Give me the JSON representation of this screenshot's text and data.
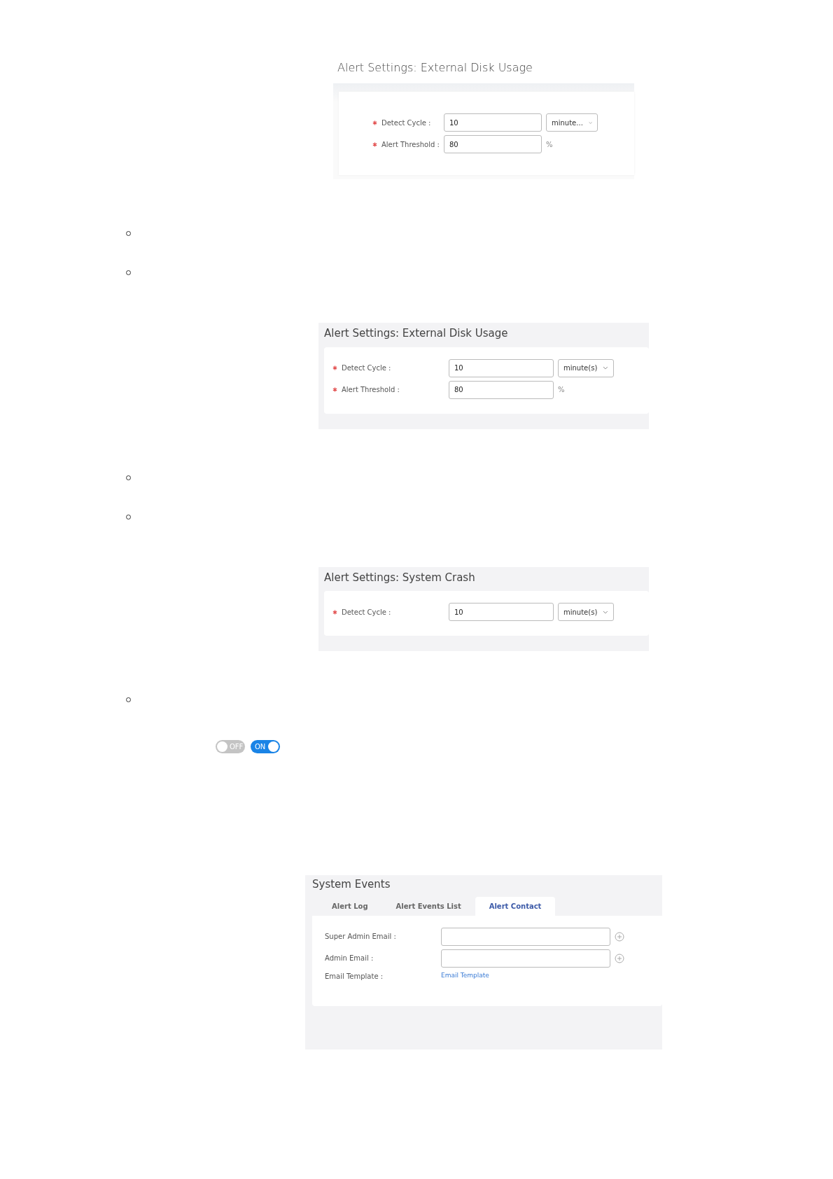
{
  "blocks": [
    {
      "kind": "framed",
      "title": "Alert Settings: External Disk Usage",
      "fields": [
        {
          "kind": "select",
          "required": true,
          "label": "Detect Cycle :",
          "value": "10",
          "option": "minute..."
        },
        {
          "kind": "suffix",
          "required": true,
          "label": "Alert Threshold :",
          "value": "80",
          "suffix": "%"
        }
      ]
    },
    {
      "kind": "bullet"
    },
    {
      "kind": "bullet"
    },
    {
      "kind": "panel",
      "title": "Alert Settings: External Disk Usage",
      "fields": [
        {
          "kind": "select",
          "required": true,
          "label": "Detect Cycle :",
          "value": "10",
          "option": "minute(s)"
        },
        {
          "kind": "suffix",
          "required": true,
          "label": "Alert Threshold :",
          "value": "80",
          "suffix": "%"
        }
      ]
    },
    {
      "kind": "bullet"
    },
    {
      "kind": "bullet"
    },
    {
      "kind": "panel",
      "title": "Alert Settings: System Crash",
      "fields": [
        {
          "kind": "select",
          "required": true,
          "label": "Detect Cycle :",
          "value": "10",
          "option": "minute(s)"
        }
      ]
    },
    {
      "kind": "bullet"
    },
    {
      "kind": "toggles",
      "items": [
        {
          "label": "OFF",
          "on": false
        },
        {
          "label": "ON",
          "on": true
        }
      ]
    },
    {
      "kind": "tabbed",
      "title": "System Events",
      "tabs": [
        {
          "label": "Alert Log",
          "selected": false
        },
        {
          "label": "Alert Events List",
          "selected": false
        },
        {
          "label": "Alert Contact",
          "selected": true
        }
      ],
      "fields": [
        {
          "kind": "add",
          "required": false,
          "label": "Super Admin Email :"
        },
        {
          "kind": "add",
          "required": false,
          "label": "Admin Email :"
        },
        {
          "kind": "link",
          "required": false,
          "label": "Email Template :",
          "link": "Email Template"
        }
      ]
    }
  ]
}
